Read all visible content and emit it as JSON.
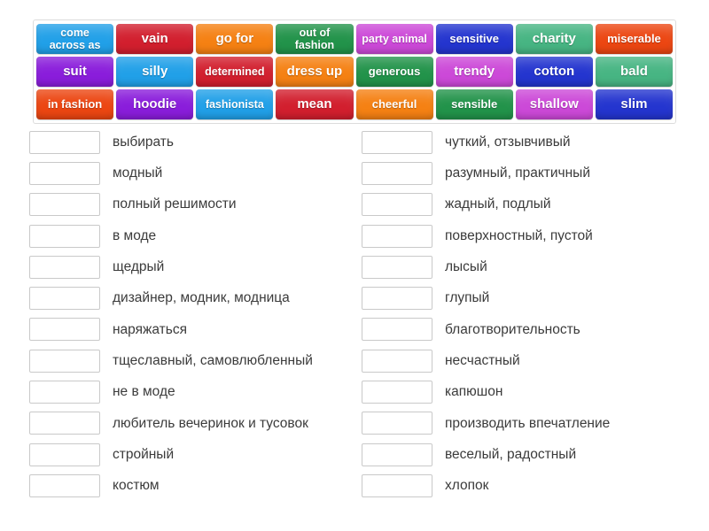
{
  "word_bank": {
    "rows": [
      [
        {
          "label": "come\nacross as",
          "color": "#21a0e8",
          "size": "two-line"
        },
        {
          "label": "vain",
          "color": "#d21f2e",
          "size": "normal"
        },
        {
          "label": "go for",
          "color": "#f58113",
          "size": "normal"
        },
        {
          "label": "out of\nfashion",
          "color": "#22934a",
          "size": "two-line"
        },
        {
          "label": "party animal",
          "color": "#cc49d8",
          "size": "xsmall"
        },
        {
          "label": "sensitive",
          "color": "#2435cf",
          "size": "small"
        },
        {
          "label": "charity",
          "color": "#47b583",
          "size": "normal"
        },
        {
          "label": "miserable",
          "color": "#ec4612",
          "size": "small"
        }
      ],
      [
        {
          "label": "suit",
          "color": "#8a1ddb",
          "size": "normal"
        },
        {
          "label": "silly",
          "color": "#21a0e8",
          "size": "normal"
        },
        {
          "label": "determined",
          "color": "#d21f2e",
          "size": "xsmall"
        },
        {
          "label": "dress up",
          "color": "#f58113",
          "size": "normal"
        },
        {
          "label": "generous",
          "color": "#22934a",
          "size": "small"
        },
        {
          "label": "trendy",
          "color": "#cc49d8",
          "size": "normal"
        },
        {
          "label": "cotton",
          "color": "#2435cf",
          "size": "normal"
        },
        {
          "label": "bald",
          "color": "#47b583",
          "size": "normal"
        }
      ],
      [
        {
          "label": "in fashion",
          "color": "#ec4612",
          "size": "small"
        },
        {
          "label": "hoodie",
          "color": "#8a1ddb",
          "size": "normal"
        },
        {
          "label": "fashionista",
          "color": "#21a0e8",
          "size": "xsmall"
        },
        {
          "label": "mean",
          "color": "#d21f2e",
          "size": "normal"
        },
        {
          "label": "cheerful",
          "color": "#f58113",
          "size": "small"
        },
        {
          "label": "sensible",
          "color": "#22934a",
          "size": "small"
        },
        {
          "label": "shallow",
          "color": "#cc49d8",
          "size": "normal"
        },
        {
          "label": "slim",
          "color": "#2435cf",
          "size": "normal"
        }
      ]
    ]
  },
  "answers": {
    "left": [
      {
        "box_value": "",
        "label": "выбирать"
      },
      {
        "box_value": "",
        "label": "модный"
      },
      {
        "box_value": "",
        "label": "полный решимости"
      },
      {
        "box_value": "",
        "label": "в моде"
      },
      {
        "box_value": "",
        "label": "щедрый"
      },
      {
        "box_value": "",
        "label": "дизайнер, модник, модница"
      },
      {
        "box_value": "",
        "label": "наряжаться"
      },
      {
        "box_value": "",
        "label": "тщеславный, самовлюбленный"
      },
      {
        "box_value": "",
        "label": "не в моде"
      },
      {
        "box_value": "",
        "label": "любитель вечеринок и тусовок"
      },
      {
        "box_value": "",
        "label": "стройный"
      },
      {
        "box_value": "",
        "label": "костюм"
      }
    ],
    "right": [
      {
        "box_value": "",
        "label": "чуткий, отзывчивый"
      },
      {
        "box_value": "",
        "label": "разумный, практичный"
      },
      {
        "box_value": "",
        "label": "жадный, подлый"
      },
      {
        "box_value": "",
        "label": "поверхностный, пустой"
      },
      {
        "box_value": "",
        "label": "лысый"
      },
      {
        "box_value": "",
        "label": "глупый"
      },
      {
        "box_value": "",
        "label": "благотворительность"
      },
      {
        "box_value": "",
        "label": "несчастный"
      },
      {
        "box_value": "",
        "label": "капюшон"
      },
      {
        "box_value": "",
        "label": "производить впечатление"
      },
      {
        "box_value": "",
        "label": "веселый, радостный"
      },
      {
        "box_value": "",
        "label": "хлопок"
      }
    ]
  }
}
